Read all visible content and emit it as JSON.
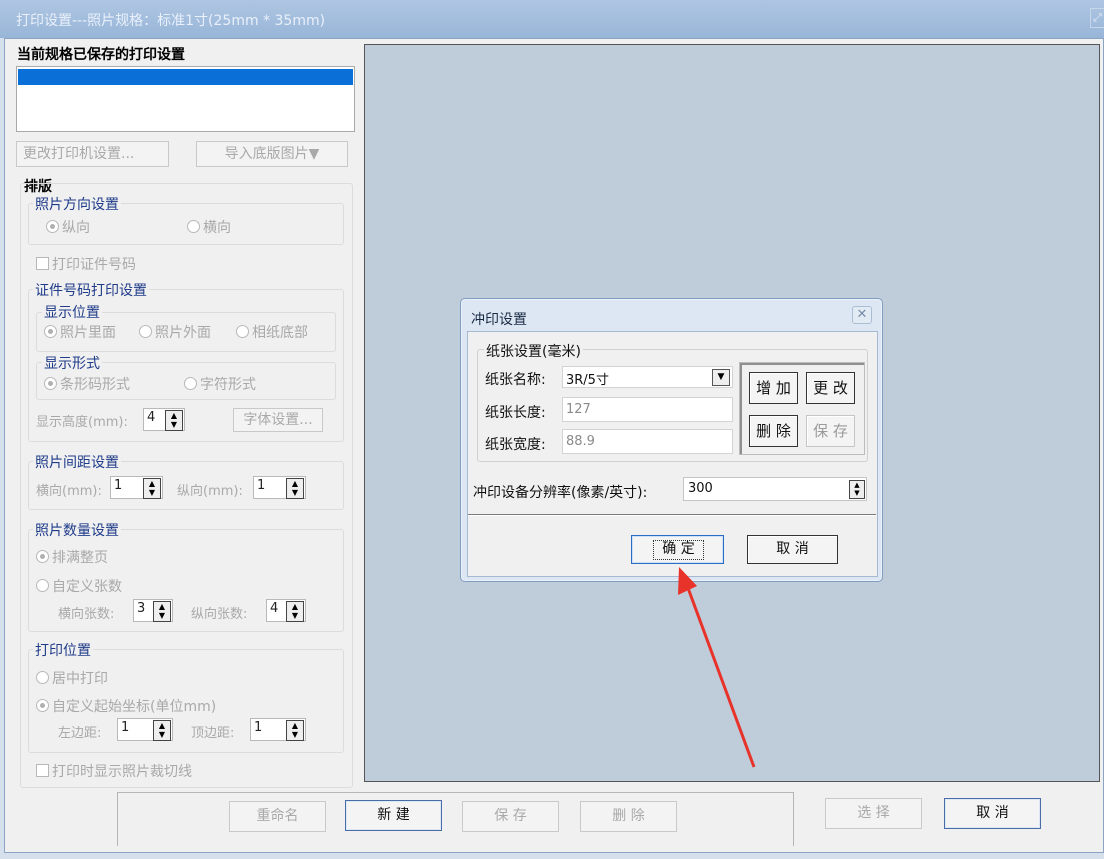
{
  "window": {
    "title": "打印设置---照片规格：标准1寸(25mm * 35mm)",
    "corner_icon": "restore-icon"
  },
  "saved": {
    "heading": "当前规格已保存的打印设置"
  },
  "buttons": {
    "change_printer": "更改打印机设置...",
    "import_template": "导入底版图片▼"
  },
  "layout": {
    "heading": "排版",
    "orientation": {
      "legend": "照片方向设置",
      "portrait": "纵向",
      "landscape": "横向"
    },
    "print_id_label": "打印证件号码",
    "idprint": {
      "legend": "证件号码打印设置",
      "position": {
        "legend": "显示位置",
        "inside": "照片里面",
        "outside": "照片外面",
        "bottom": "相纸底部"
      },
      "form": {
        "legend": "显示形式",
        "barcode": "条形码形式",
        "text": "字符形式"
      },
      "height_label": "显示高度(mm):",
      "height_value": "4",
      "font_button": "字体设置..."
    },
    "spacing": {
      "legend": "照片间距设置",
      "h_label": "横向(mm):",
      "h_value": "1",
      "v_label": "纵向(mm):",
      "v_value": "1"
    },
    "quantity": {
      "legend": "照片数量设置",
      "fill": "排满整页",
      "custom": "自定义张数",
      "h_label": "横向张数:",
      "h_value": "3",
      "v_label": "纵向张数:",
      "v_value": "4"
    },
    "position": {
      "legend": "打印位置",
      "center": "居中打印",
      "custom": "自定义起始坐标(单位mm)",
      "left_label": "左边距:",
      "left_value": "1",
      "top_label": "顶边距:",
      "top_value": "1"
    },
    "cutline_label": "打印时显示照片裁切线"
  },
  "bottom": {
    "rename": "重命名",
    "new": "新 建",
    "save": "保 存",
    "delete": "删 除",
    "select": "选 择",
    "cancel": "取 消"
  },
  "dialog": {
    "title": "冲印设置",
    "paper_legend": "纸张设置(毫米)",
    "name_label": "纸张名称:",
    "name_value": "3R/5寸",
    "length_label": "纸张长度:",
    "length_value": "127",
    "width_label": "纸张宽度:",
    "width_value": "88.9",
    "add": "增 加",
    "modify": "更 改",
    "remove": "删 除",
    "save": "保 存",
    "dpi_label": "冲印设备分辨率(像素/英寸):",
    "dpi_value": "300",
    "ok": "确 定",
    "cancel": "取 消"
  },
  "colors": {
    "selection": "#0a6fd6",
    "preview_bg": "#bfcddb",
    "arrow": "#e8332a"
  }
}
